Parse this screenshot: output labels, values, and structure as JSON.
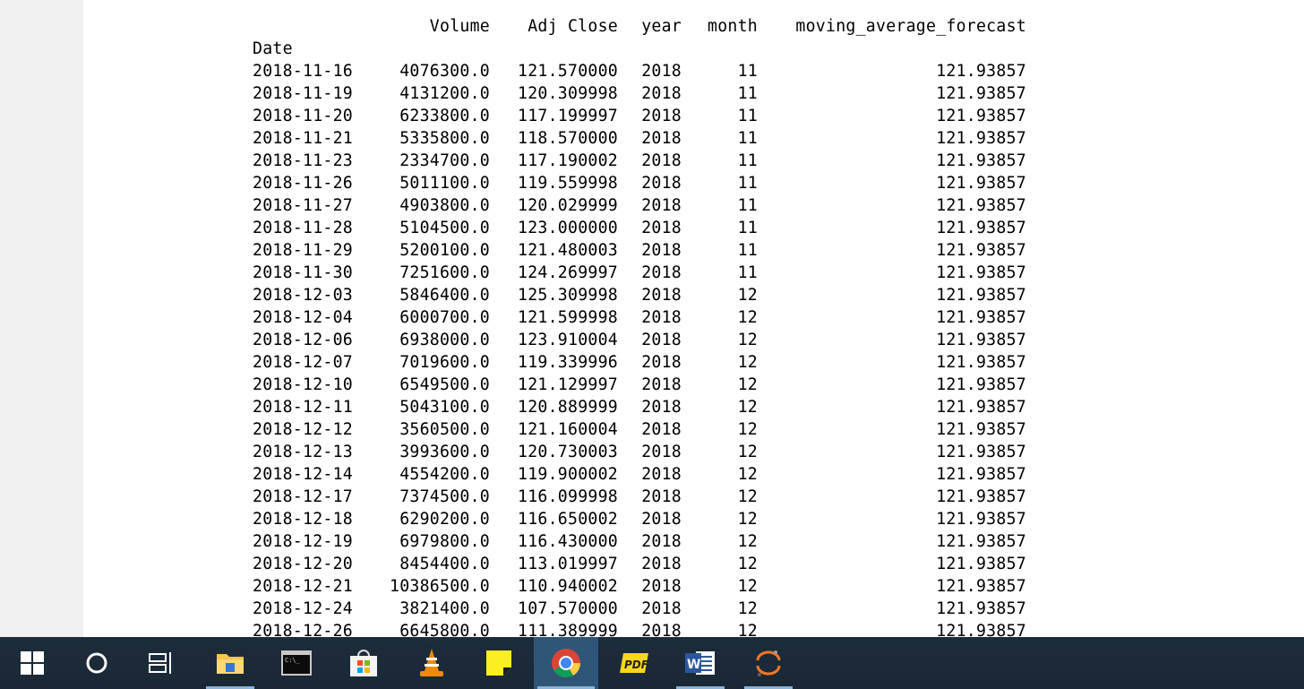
{
  "table": {
    "headers": {
      "volume": "Volume",
      "adj_close": "Adj Close",
      "year": "year",
      "month": "month",
      "moving_average_forecast": "moving_average_forecast"
    },
    "index_name": "Date",
    "rows": [
      {
        "date": "2018-11-16",
        "volume": "4076300.0",
        "adj_close": "121.570000",
        "year": "2018",
        "month": "11",
        "mav": "121.93857"
      },
      {
        "date": "2018-11-19",
        "volume": "4131200.0",
        "adj_close": "120.309998",
        "year": "2018",
        "month": "11",
        "mav": "121.93857"
      },
      {
        "date": "2018-11-20",
        "volume": "6233800.0",
        "adj_close": "117.199997",
        "year": "2018",
        "month": "11",
        "mav": "121.93857"
      },
      {
        "date": "2018-11-21",
        "volume": "5335800.0",
        "adj_close": "118.570000",
        "year": "2018",
        "month": "11",
        "mav": "121.93857"
      },
      {
        "date": "2018-11-23",
        "volume": "2334700.0",
        "adj_close": "117.190002",
        "year": "2018",
        "month": "11",
        "mav": "121.93857"
      },
      {
        "date": "2018-11-26",
        "volume": "5011100.0",
        "adj_close": "119.559998",
        "year": "2018",
        "month": "11",
        "mav": "121.93857"
      },
      {
        "date": "2018-11-27",
        "volume": "4903800.0",
        "adj_close": "120.029999",
        "year": "2018",
        "month": "11",
        "mav": "121.93857"
      },
      {
        "date": "2018-11-28",
        "volume": "5104500.0",
        "adj_close": "123.000000",
        "year": "2018",
        "month": "11",
        "mav": "121.93857"
      },
      {
        "date": "2018-11-29",
        "volume": "5200100.0",
        "adj_close": "121.480003",
        "year": "2018",
        "month": "11",
        "mav": "121.93857"
      },
      {
        "date": "2018-11-30",
        "volume": "7251600.0",
        "adj_close": "124.269997",
        "year": "2018",
        "month": "11",
        "mav": "121.93857"
      },
      {
        "date": "2018-12-03",
        "volume": "5846400.0",
        "adj_close": "125.309998",
        "year": "2018",
        "month": "12",
        "mav": "121.93857"
      },
      {
        "date": "2018-12-04",
        "volume": "6000700.0",
        "adj_close": "121.599998",
        "year": "2018",
        "month": "12",
        "mav": "121.93857"
      },
      {
        "date": "2018-12-06",
        "volume": "6938000.0",
        "adj_close": "123.910004",
        "year": "2018",
        "month": "12",
        "mav": "121.93857"
      },
      {
        "date": "2018-12-07",
        "volume": "7019600.0",
        "adj_close": "119.339996",
        "year": "2018",
        "month": "12",
        "mav": "121.93857"
      },
      {
        "date": "2018-12-10",
        "volume": "6549500.0",
        "adj_close": "121.129997",
        "year": "2018",
        "month": "12",
        "mav": "121.93857"
      },
      {
        "date": "2018-12-11",
        "volume": "5043100.0",
        "adj_close": "120.889999",
        "year": "2018",
        "month": "12",
        "mav": "121.93857"
      },
      {
        "date": "2018-12-12",
        "volume": "3560500.0",
        "adj_close": "121.160004",
        "year": "2018",
        "month": "12",
        "mav": "121.93857"
      },
      {
        "date": "2018-12-13",
        "volume": "3993600.0",
        "adj_close": "120.730003",
        "year": "2018",
        "month": "12",
        "mav": "121.93857"
      },
      {
        "date": "2018-12-14",
        "volume": "4554200.0",
        "adj_close": "119.900002",
        "year": "2018",
        "month": "12",
        "mav": "121.93857"
      },
      {
        "date": "2018-12-17",
        "volume": "7374500.0",
        "adj_close": "116.099998",
        "year": "2018",
        "month": "12",
        "mav": "121.93857"
      },
      {
        "date": "2018-12-18",
        "volume": "6290200.0",
        "adj_close": "116.650002",
        "year": "2018",
        "month": "12",
        "mav": "121.93857"
      },
      {
        "date": "2018-12-19",
        "volume": "6979800.0",
        "adj_close": "116.430000",
        "year": "2018",
        "month": "12",
        "mav": "121.93857"
      },
      {
        "date": "2018-12-20",
        "volume": "8454400.0",
        "adj_close": "113.019997",
        "year": "2018",
        "month": "12",
        "mav": "121.93857"
      },
      {
        "date": "2018-12-21",
        "volume": "10386500.0",
        "adj_close": "110.940002",
        "year": "2018",
        "month": "12",
        "mav": "121.93857"
      },
      {
        "date": "2018-12-24",
        "volume": "3821400.0",
        "adj_close": "107.570000",
        "year": "2018",
        "month": "12",
        "mav": "121.93857"
      },
      {
        "date": "2018-12-26",
        "volume": "6645800.0",
        "adj_close": "111.389999",
        "year": "2018",
        "month": "12",
        "mav": "121.93857"
      }
    ]
  },
  "taskbar": {
    "items": [
      {
        "name": "start-button",
        "icon": "windows-logo-icon",
        "active": false,
        "open": false
      },
      {
        "name": "cortana-button",
        "icon": "cortana-circle-icon",
        "active": false,
        "open": false
      },
      {
        "name": "task-view-button",
        "icon": "task-view-icon",
        "active": false,
        "open": false
      },
      {
        "name": "file-explorer-button",
        "icon": "folder-icon",
        "active": false,
        "open": true
      },
      {
        "name": "command-prompt-button",
        "icon": "terminal-icon",
        "active": false,
        "open": false
      },
      {
        "name": "microsoft-store-button",
        "icon": "store-bag-icon",
        "active": false,
        "open": false
      },
      {
        "name": "vlc-button",
        "icon": "vlc-cone-icon",
        "active": false,
        "open": false
      },
      {
        "name": "sticky-notes-button",
        "icon": "sticky-note-icon",
        "active": false,
        "open": false
      },
      {
        "name": "chrome-button",
        "icon": "chrome-icon",
        "active": true,
        "open": true
      },
      {
        "name": "pdf-reader-button",
        "icon": "pdf-icon",
        "active": false,
        "open": false
      },
      {
        "name": "word-button",
        "icon": "word-icon",
        "active": false,
        "open": true
      },
      {
        "name": "jupyter-button",
        "icon": "jupyter-icon",
        "active": false,
        "open": true
      }
    ],
    "pdf_icon_label": "PDF",
    "word_icon_label": "W"
  }
}
